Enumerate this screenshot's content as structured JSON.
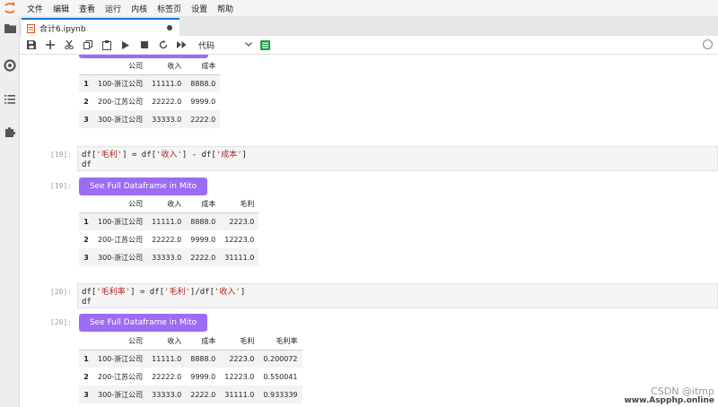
{
  "menu": [
    "文件",
    "编辑",
    "查看",
    "运行",
    "内核",
    "标签页",
    "设置",
    "帮助"
  ],
  "tab": {
    "label": "合计6.ipynb"
  },
  "toolbar": {
    "cell_type": "代码"
  },
  "cells": [
    {
      "code_prompt": "",
      "code": [],
      "out_prompt": "",
      "button": "",
      "table": {
        "headers": [
          "",
          "公司",
          "收入",
          "成本"
        ],
        "rows": [
          [
            "1",
            "100-浙江公司",
            "11111.0",
            "8888.0"
          ],
          [
            "2",
            "200-江苏公司",
            "22222.0",
            "9999.0"
          ],
          [
            "3",
            "300-浙江公司",
            "33333.0",
            "2222.0"
          ]
        ]
      }
    },
    {
      "code_prompt": "[19]:",
      "code": [
        "df['毛利'] = df['收入'] - df['成本']",
        "df"
      ],
      "out_prompt": "[19]:",
      "button": "See Full Dataframe in Mito",
      "table": {
        "headers": [
          "",
          "公司",
          "收入",
          "成本",
          "毛利"
        ],
        "rows": [
          [
            "1",
            "100-浙江公司",
            "11111.0",
            "8888.0",
            "2223.0"
          ],
          [
            "2",
            "200-江苏公司",
            "22222.0",
            "9999.0",
            "12223.0"
          ],
          [
            "3",
            "300-浙江公司",
            "33333.0",
            "2222.0",
            "31111.0"
          ]
        ]
      }
    },
    {
      "code_prompt": "[20]:",
      "code": [
        "df['毛利率'] = df['毛利']/df['收入']",
        "df"
      ],
      "out_prompt": "[20]:",
      "button": "See Full Dataframe in Mito",
      "table": {
        "headers": [
          "",
          "公司",
          "收入",
          "成本",
          "毛利",
          "毛利率"
        ],
        "rows": [
          [
            "1",
            "100-浙江公司",
            "11111.0",
            "8888.0",
            "2223.0",
            "0.200072"
          ],
          [
            "2",
            "200-江苏公司",
            "22222.0",
            "9999.0",
            "12223.0",
            "0.550041"
          ],
          [
            "3",
            "300-浙江公司",
            "33333.0",
            "2222.0",
            "31111.0",
            "0.933339"
          ]
        ]
      }
    }
  ],
  "watermark": {
    "line1": "CSDN @itmp",
    "line2": "www.Aspphp.online"
  }
}
